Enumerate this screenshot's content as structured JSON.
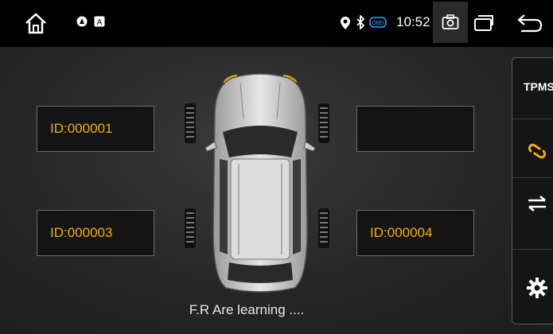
{
  "statusbar": {
    "time": "10:52",
    "obd_label": "OBD",
    "notif2_label": "A",
    "icons": [
      "home-icon",
      "notification-icon",
      "notification-app-icon",
      "location-icon",
      "bluetooth-icon",
      "obd-icon",
      "screenshot-icon",
      "recent-apps-icon",
      "back-icon"
    ]
  },
  "tpms": {
    "front_left_id": "ID:000001",
    "front_right_id": "",
    "rear_left_id": "ID:000003",
    "rear_right_id": "ID:000004",
    "status_message": "F.R Are learning ...."
  },
  "side_panel": {
    "title": "TPMS",
    "items": [
      "learn-icon",
      "swap-icon",
      "settings-icon"
    ]
  },
  "colors": {
    "accent": "#f0b000",
    "background": "#1a1a1a",
    "statusbar": "#000000"
  }
}
